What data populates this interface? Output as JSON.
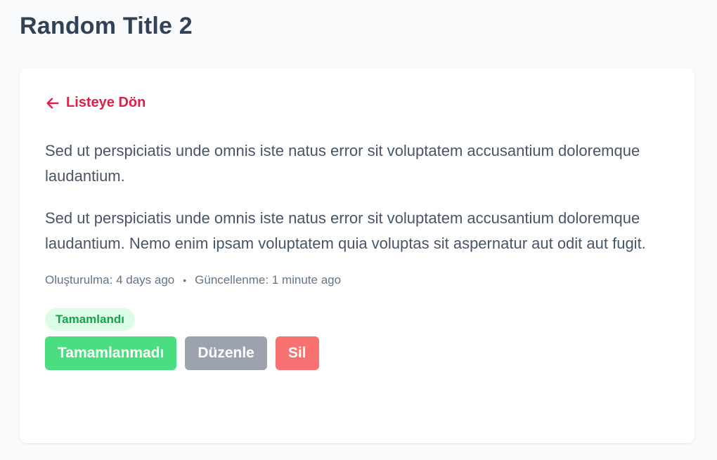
{
  "page": {
    "title": "Random Title 2"
  },
  "card": {
    "back_link_label": "Listeye Dön",
    "paragraphs": [
      "Sed ut perspiciatis unde omnis iste natus error sit voluptatem accusantium doloremque laudantium.",
      "Sed ut perspiciatis unde omnis iste natus error sit voluptatem accusantium doloremque laudantium. Nemo enim ipsam voluptatem quia voluptas sit aspernatur aut odit aut fugit."
    ],
    "meta": {
      "created": "Oluşturulma: 4 days ago",
      "separator": "•",
      "updated": "Güncellenme: 1 minute ago"
    },
    "status_badge": "Tamamlandı",
    "actions": {
      "toggle_label": "Tamamlanmadı",
      "edit_label": "Düzenle",
      "delete_label": "Sil"
    }
  },
  "icons": {
    "back": "arrow-left-icon"
  },
  "colors": {
    "accent": "#e11d48",
    "success": "#4ade80",
    "success_badge_bg": "#dcfce7",
    "success_badge_text": "#16a34a",
    "neutral": "#9ca3af",
    "danger": "#f87171"
  }
}
